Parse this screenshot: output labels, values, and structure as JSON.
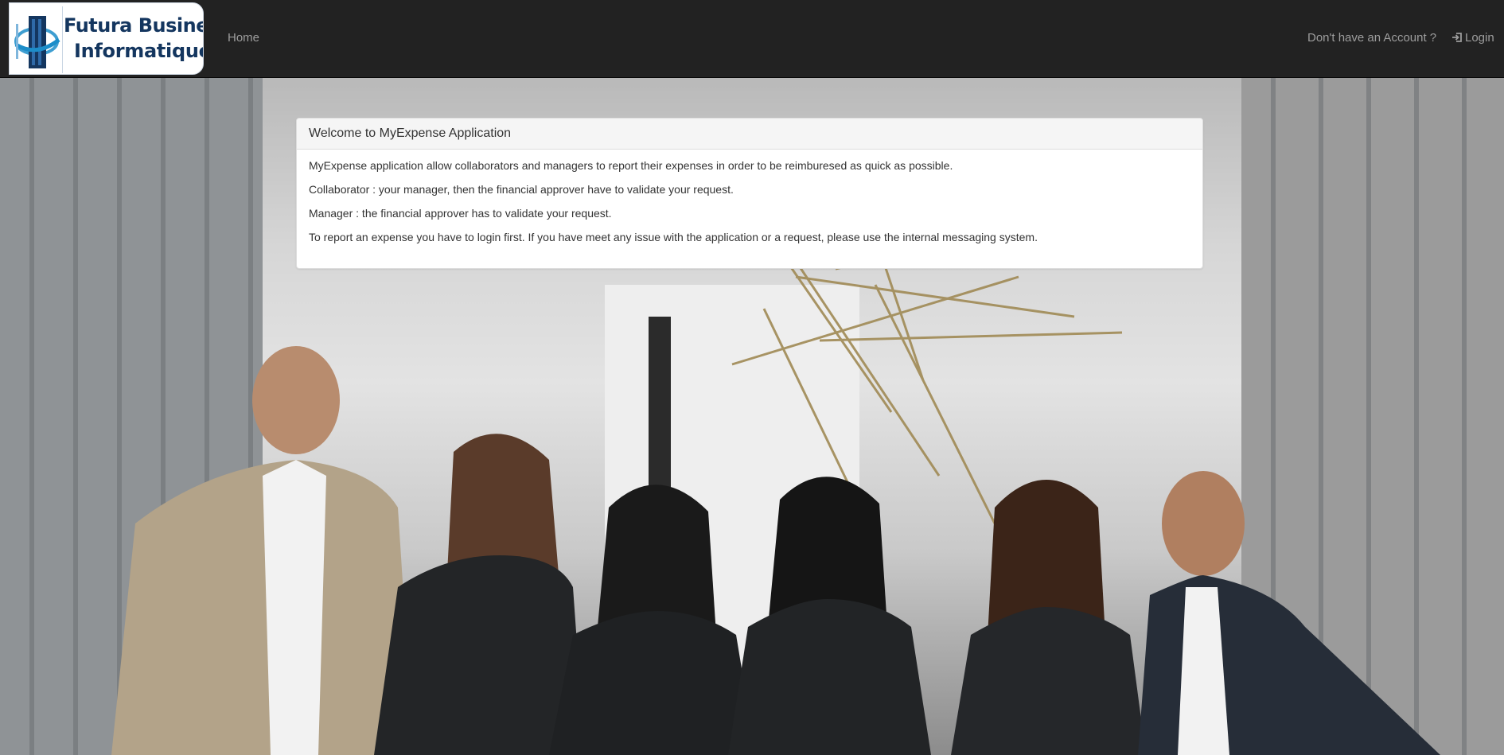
{
  "brand": {
    "logo_line1": "Futura Business",
    "logo_line2": "Informatique",
    "logo_icon": "building-logo-icon",
    "colors": {
      "logo_text": "#14365f",
      "logo_accent": "#1c8dc9"
    }
  },
  "navbar": {
    "home_label": "Home",
    "register_label": "Don't have an Account ?",
    "login_label": "Login",
    "login_icon": "sign-in-icon",
    "colors": {
      "background": "#222222",
      "link": "#9d9d9d"
    }
  },
  "panel": {
    "heading": "Welcome to MyExpense Application",
    "paragraphs": [
      "MyExpense application allow collaborators and managers to report their expenses in order to be reimburesed as quick as possible.",
      "Collaborator : your manager, then the financial approver have to validate your request.",
      "Manager : the financial approver has to validate your request.",
      "To report an expense you have to login first. If you have meet any issue with the application or a request, please use the internal messaging system."
    ]
  }
}
